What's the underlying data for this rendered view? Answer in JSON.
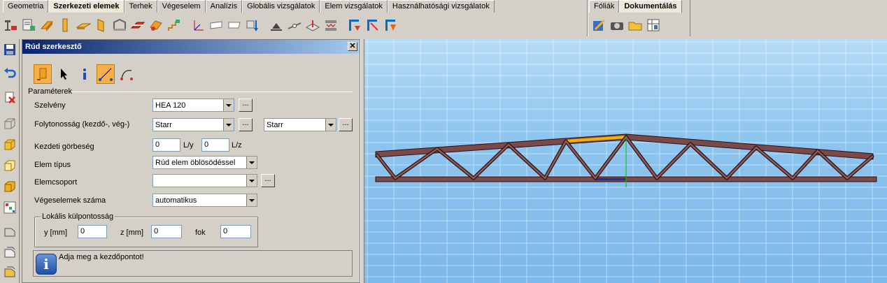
{
  "tabs": [
    {
      "label": "Geometria",
      "active": false
    },
    {
      "label": "Szerkezeti elemek",
      "active": true
    },
    {
      "label": "Terhek",
      "active": false
    },
    {
      "label": "Végeselem",
      "active": false
    },
    {
      "label": "Analízis",
      "active": false
    },
    {
      "label": "Globális vizsgálatok",
      "active": false
    },
    {
      "label": "Elem vizsgálatok",
      "active": false
    },
    {
      "label": "Használhatósági vizsgálatok",
      "active": false
    }
  ],
  "right_tabs": [
    {
      "label": "Fóliák",
      "active": false
    },
    {
      "label": "Dokumentálás",
      "active": true
    }
  ],
  "dialog": {
    "title": "Rúd szerkesztő",
    "close_label": "✕",
    "section_parameters": "Paraméterek",
    "profile_label": "Szelvény",
    "profile_value": "HEA 120",
    "continuity_label": "Folytonosság (kezdő-, vég-)",
    "continuity_start": "Starr",
    "continuity_end": "Starr",
    "curvature_label": "Kezdeti görbeség",
    "curvature_ly": "0",
    "curvature_ly_unit": "L/y",
    "curvature_lz": "0",
    "curvature_lz_unit": "L/z",
    "element_type_label": "Elem típus",
    "element_type_value": "Rúd elem öblösödéssel",
    "group_label": "Elemcsoport",
    "group_value": "",
    "fe_count_label": "Végeselemek száma",
    "fe_count_value": "automatikus",
    "dots_label": "...",
    "eccentricity_title": "Lokális külpontosság",
    "ecc_y_label": "y [mm]",
    "ecc_y_value": "0",
    "ecc_z_label": "z [mm]",
    "ecc_z_value": "0",
    "ecc_deg_label": "fok",
    "ecc_deg_value": "0",
    "info_icon": "i",
    "info_text": "Adja meg a kezdőpontot!"
  },
  "colors": {
    "truss": "#7a4a4a",
    "highlight_top": "#f0b400",
    "highlight_bottom": "#1a2fa0",
    "axis_green": "#00c000",
    "grid": "#ffffff"
  }
}
